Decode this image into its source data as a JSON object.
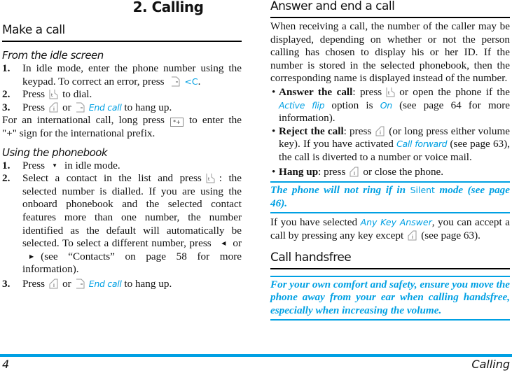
{
  "chapter_title": "2. Calling",
  "left": {
    "section_title": "Make a call",
    "idle": {
      "heading": "From the idle screen",
      "step1_num": "1.",
      "step1_text": "In idle mode, enter the phone number using the keypad. To correct an error, press",
      "step1_menu": "<C",
      "step1_end": ".",
      "step2_num": "2.",
      "step2_pre": "Press",
      "step2_post": "to dial.",
      "step3_num": "3.",
      "step3_pre": "Press",
      "step3_or": "or",
      "step3_menu": "End call",
      "step3_post": "to hang up.",
      "intl_pre": "For an international call, long press",
      "intl_key": "*+",
      "intl_post": "to enter the \"+\" sign for the international prefix."
    },
    "phonebook": {
      "heading": "Using the phonebook",
      "step1_num": "1.",
      "step1_pre": "Press",
      "step1_post": "in idle mode.",
      "step2_num": "2.",
      "step2_pre": "Select a contact in the list and press",
      "step2_post": ": the selected number is dialled. If you are using the onboard phonebook and the selected contact features more than one number, the number identified as the default will automatically be selected. To select a different number, press",
      "step2_or": "or",
      "step2_end": "(see “Contacts” on page 58 for more information).",
      "step3_num": "3.",
      "step3_pre": "Press",
      "step3_or": "or",
      "step3_menu": "End call",
      "step3_post": "to hang up."
    }
  },
  "right": {
    "section_title": "Answer and end a call",
    "intro": "When receiving a call, the number of the caller may be displayed, depending on whether or not the person calling has chosen to display his or her ID. If the number is stored in the selected phonebook, then the corresponding name is displayed instead of the number.",
    "bullets": {
      "answer_label": "Answer the call",
      "answer_pre": ": press",
      "answer_mid": "or open the phone if the",
      "answer_menu": "Active flip",
      "answer_mid2": "option is",
      "answer_menu2": "On",
      "answer_post": "(see page 64 for more information).",
      "reject_label": "Reject the call",
      "reject_pre": ": press",
      "reject_mid": "(or long press either volume key). If you have activated",
      "reject_menu": "Call forward",
      "reject_post": "(see page 63), the call is diverted to a number or voice mail.",
      "hang_label": "Hang up",
      "hang_pre": ": press",
      "hang_post": "or close the phone."
    },
    "note1_pre": "The phone will not ring if in",
    "note1_menu": "Silent",
    "note1_post": "mode (see page 46).",
    "anykey_pre": "If you have selected",
    "anykey_menu": "Any Key Answer",
    "anykey_mid": ", you can accept a call by pressing any key except",
    "anykey_post": "(see page 63).",
    "handsfree_title": "Call handsfree",
    "note2": "For your own comfort and safety, ensure you move the phone away from your ear when calling handsfree, especially when increasing the volume."
  },
  "footer": {
    "page_number": "4",
    "chapter_name": "Calling"
  },
  "colors": {
    "accent": "#00a0e3",
    "text": "#111111"
  }
}
